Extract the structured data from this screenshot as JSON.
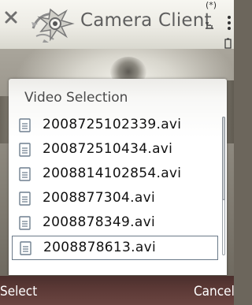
{
  "statusbar": {
    "title": "Camera Client",
    "bluetooth_glyph": "(*)"
  },
  "dialog": {
    "title": "Video Selection",
    "files": [
      "2008725102339.avi",
      "200872510434.avi",
      "2008814102854.avi",
      "2008877304.avi",
      "2008878349.avi",
      "2008878613.avi"
    ],
    "selected_index": 5,
    "scroll_fraction_visible": 0.6
  },
  "softkeys": {
    "left": "Select",
    "right": "Cancel"
  },
  "colors": {
    "softkey_bar": "#5a3835",
    "title_text": "#5e5e5e",
    "selection_border": "#6b7a89"
  },
  "icons": {
    "close": "close-icon",
    "logo": "camera-client-logo",
    "file": "document-icon",
    "bluetooth": "bluetooth-icon",
    "network": "network-icon",
    "battery": "battery-icon"
  }
}
